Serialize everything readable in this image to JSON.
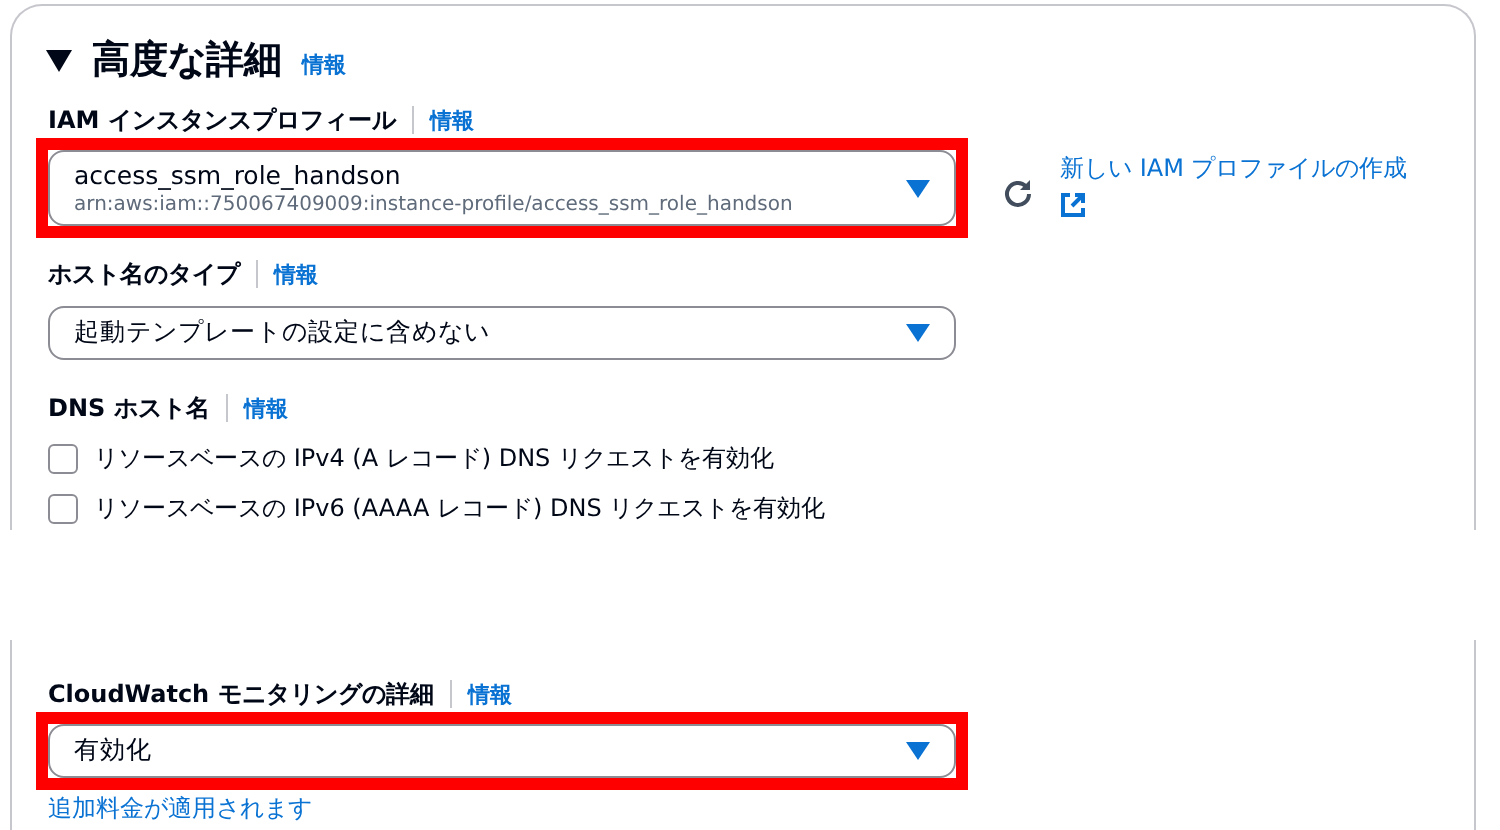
{
  "section": {
    "title": "高度な詳細",
    "info": "情報",
    "expanded": true
  },
  "fields": [
    {
      "kind": "select",
      "label": "IAM インスタンスプロフィール",
      "info": "情報",
      "value": "access_ssm_role_handson",
      "description": "arn:aws:iam::750067409009:instance-profile/access_ssm_role_handson",
      "highlighted": true,
      "refresh": true,
      "link": "新しい IAM プロファイルの作成"
    },
    {
      "kind": "select",
      "label": "ホスト名のタイプ",
      "info": "情報",
      "value": "起動テンプレートの設定に含めない",
      "highlighted": false
    },
    {
      "kind": "checkboxes",
      "label": "DNS ホスト名",
      "info": "情報",
      "options": [
        {
          "label": "リソースベースの IPv4 (A レコード) DNS リクエストを有効化",
          "checked": false
        },
        {
          "label": "リソースベースの IPv6 (AAAA レコード) DNS リクエストを有効化",
          "checked": false
        }
      ]
    }
  ],
  "lower_fields": [
    {
      "kind": "select",
      "label": "CloudWatch モニタリングの詳細",
      "info": "情報",
      "value": "有効化",
      "highlighted": true,
      "note": "追加料金が適用されます"
    }
  ]
}
